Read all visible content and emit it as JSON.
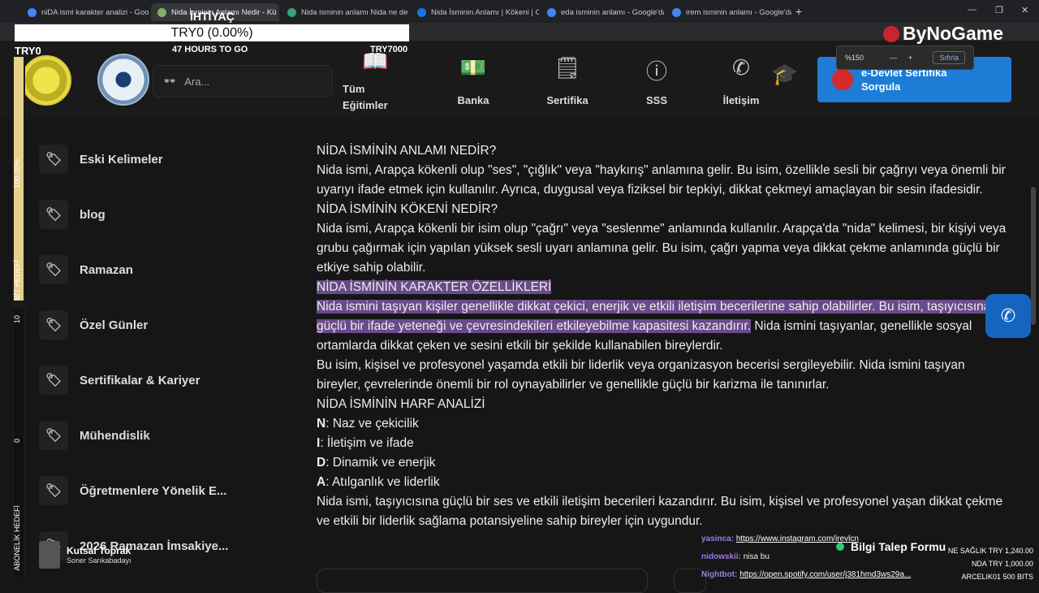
{
  "tabs": [
    {
      "title": "niDA ismi karakter analizi - Goo",
      "color": "#4285f4"
    },
    {
      "title": "Nida İsminin Anlamı Nedir - Kü",
      "color": "#7bb36b"
    },
    {
      "title": "Nida isminin anlamı Nida ne de",
      "color": "#3aa17a"
    },
    {
      "title": "Nida İsminin Anlamı | Kökeni | C",
      "color": "#1a73e8"
    },
    {
      "title": "eda isminin anlamı - Google'da",
      "color": "#4285f4"
    },
    {
      "title": "irem isminin anlamı - Google'da",
      "color": "#4285f4"
    }
  ],
  "browser": {
    "new_tab": "+",
    "minimize": "—",
    "maximize": "❐",
    "close": "✕"
  },
  "zoom": {
    "level": "%150",
    "minus": "—",
    "plus": "+",
    "reset": "Sıfırla"
  },
  "overlay": {
    "goal_title": "İHTİYAÇ",
    "goal_value": "TRY0 (0.00%)",
    "goal_left": "TRY0",
    "goal_center": "47 HOURS TO GO",
    "goal_right": "TRY7000",
    "brand": "ByNoGame",
    "bar_top": "100.00%",
    "bar_label1": "BİT HEDEFİ",
    "bar_num1": "10",
    "bar_num2": "0",
    "bar_label2": "ABONELİK HEDEFİ"
  },
  "header": {
    "search_placeholder": "Ara...",
    "nav": [
      "Tüm Eğitimler",
      "Banka",
      "Sertifika",
      "SSS",
      "İletişim"
    ],
    "edevlet": "e-Devlet Sertifika Sorgula"
  },
  "sidebar": [
    "Eski Kelimeler",
    "blog",
    "Ramazan",
    "Özel Günler",
    "Sertifikalar & Kariyer",
    "Mühendislik",
    "Öğretmenlere Yönelik E...",
    "2026 Ramazan İmsakiye..."
  ],
  "content": {
    "h1": "NİDA İSMİNİN ANLAMI NEDİR?",
    "p1": "Nida ismi, Arapça kökenli olup \"ses\", \"çığlık\" veya \"haykırış\" anlamına gelir. Bu isim, özellikle sesli bir çağrıyı veya önemli bir uyarıyı ifade etmek için kullanılır. Ayrıca, duygusal veya fiziksel bir tepkiyi, dikkat çekmeyi amaçlayan bir sesin ifadesidir.",
    "h2": "NİDA İSMİNİN KÖKENİ NEDİR?",
    "p2": "Nida ismi, Arapça kökenli bir isim olup \"çağrı\" veya \"seslenme\" anlamında kullanılır. Arapça'da \"nida\" kelimesi, bir kişiyi veya grubu çağırmak için yapılan yüksek sesli uyarı anlamına gelir. Bu isim, çağrı yapma veya dikkat çekme anlamında güçlü bir etkiye sahip olabilir.",
    "h3": "NİDA İSMİNİN KARAKTER ÖZELLİKLERİ",
    "p3_hl": "Nida ismini taşıyan kişiler genellikle dikkat çekici, enerjik ve etkili iletişim becerilerine sahip olabilirler. Bu isim, taşıyıcısına güçlü bir ifade yeteneği ve çevresindekileri etkileyebilme kapasitesi kazandırır.",
    "p3_rest": " Nida ismini taşıyanlar, genellikle sosyal ortamlarda dikkat çeken ve sesini etkili bir şekilde kullanabilen bireylerdir.",
    "p4": "Bu isim, kişisel ve profesyonel yaşamda etkili bir liderlik veya organizasyon becerisi sergileyebilir. Nida ismini taşıyan bireyler, çevrelerinde önemli bir rol oynayabilirler ve genellikle güçlü bir karizma ile tanınırlar.",
    "h4": "NİDA İSMİNİN HARF ANALİZİ",
    "letters": [
      {
        "l": "N",
        "t": ": Naz ve çekicilik"
      },
      {
        "l": "I",
        "t": ": İletişim ve ifade"
      },
      {
        "l": "D",
        "t": ": Dinamik ve enerjik"
      },
      {
        "l": "A",
        "t": ": Atılganlık ve liderlik"
      }
    ],
    "p5": "Nida ismi, taşıyıcısına güçlü bir ses ve etkili iletişim becerileri kazandırır. Bu isim, kişisel ve profesyonel yaşan dikkat çekme ve etkili bir liderlik sağlama potansiyeline sahip bireyler için uygundur."
  },
  "chat": [
    {
      "user": "yasinca:",
      "text": "https://www.instagram.com/irevlcn"
    },
    {
      "user": "nidowskii:",
      "text": "nisa bu"
    },
    {
      "user": "Nightbot:",
      "text": "https://open.spotify.com/user/j381hmd3ws29a..."
    }
  ],
  "bilgi": "Bilgi Talep Formu",
  "donations": [
    "NE SAĞLIK TRY 1,240.00",
    "NDA TRY 1,000.00",
    "ARCELIK01 500 BITS"
  ],
  "streamer": {
    "name": "Kutsal Toprak",
    "sub": "Soner Sarıkabadayı"
  },
  "whatsapp_icon": "whatsapp-icon"
}
